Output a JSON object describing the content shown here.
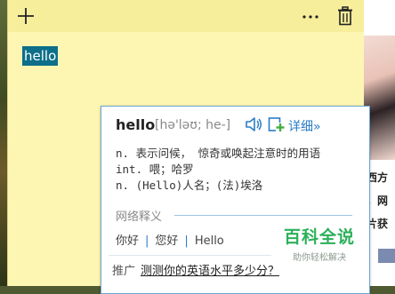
{
  "sticky_note": {
    "text": "hello"
  },
  "background_page": {
    "fragments": [
      "西方",
      "，网",
      "片获"
    ]
  },
  "dictionary_popup": {
    "word": "hello",
    "phonetic": "[hə'ləʊ; he-]",
    "detail_link": "详细»",
    "definitions": [
      "n. 表示问候， 惊奇或唤起注意时的用语",
      "int. 喂；哈罗",
      "n. (Hello)人名；(法)埃洛"
    ],
    "web_section_label": "网络释义",
    "web_definitions": [
      "你好",
      "您好",
      "Hello"
    ],
    "promo_label": "推广",
    "promo_link": "测测你的英语水平多少分？"
  },
  "watermark": {
    "main": "百科全说",
    "sub": "助你轻松解决"
  },
  "icons": {
    "add": "plus-icon",
    "menu": "more-icon",
    "delete": "trash-icon",
    "pronounce": "speaker-icon",
    "add_wordbook": "add-wordbook-icon"
  },
  "colors": {
    "note_background": "#fdf6b3",
    "note_header": "#f7ee9c",
    "selection": "#0d6f8a",
    "popup_border": "#6aa6cf",
    "link": "#2a7cc7",
    "watermark_green": "#2bb05a"
  }
}
